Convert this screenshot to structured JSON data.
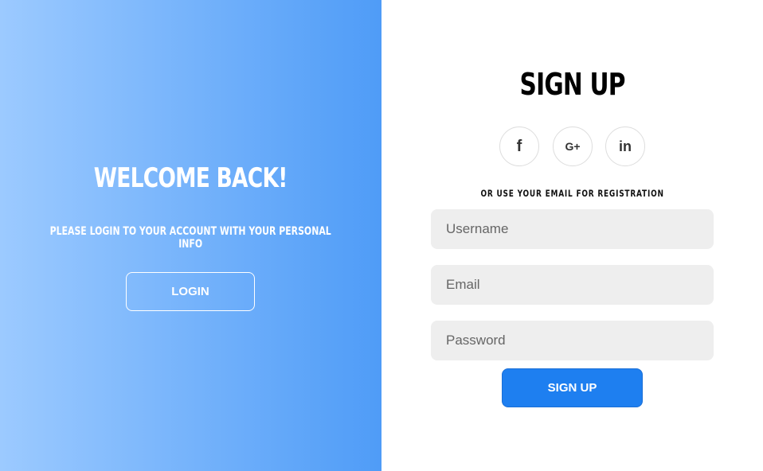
{
  "left": {
    "title": "WELCOME BACK!",
    "subtitle": "PLEASE LOGIN TO YOUR ACCOUNT WITH YOUR PERSONAL INFO",
    "login_label": "LOGIN"
  },
  "right": {
    "title": "SIGN UP",
    "social": [
      {
        "icon": "facebook-icon",
        "glyph": "f"
      },
      {
        "icon": "google-plus-icon",
        "glyph": "G+"
      },
      {
        "icon": "linkedin-icon",
        "glyph": "in"
      }
    ],
    "divider_text": "OR USE YOUR EMAIL FOR REGISTRATION",
    "username": {
      "value": "",
      "placeholder": "Username"
    },
    "email": {
      "value": "",
      "placeholder": "Email"
    },
    "password": {
      "value": "",
      "placeholder": "Password"
    },
    "signup_label": "SIGN UP"
  },
  "colors": {
    "gradient_start": "#9ccaff",
    "gradient_end": "#4f9cf7",
    "primary_button": "#1e7ff0",
    "input_bg": "#eeeeee"
  }
}
